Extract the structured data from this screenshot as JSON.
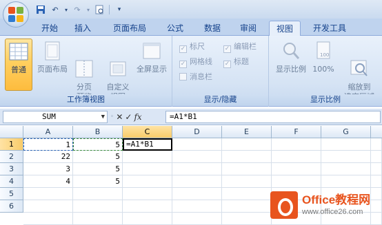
{
  "quick_access": {
    "icons": [
      "save-icon",
      "undo-icon",
      "redo-icon",
      "print-preview-icon",
      "customize-icon"
    ]
  },
  "tabs": [
    {
      "label": "开始"
    },
    {
      "label": "插入"
    },
    {
      "label": "页面布局"
    },
    {
      "label": "公式"
    },
    {
      "label": "数据"
    },
    {
      "label": "审阅"
    },
    {
      "label": "视图",
      "active": true
    },
    {
      "label": "开发工具"
    }
  ],
  "ribbon": {
    "groups": {
      "workbook_views": {
        "label": "工作簿视图",
        "buttons": [
          {
            "label": "普通",
            "active": true
          },
          {
            "label": "页面布局"
          },
          {
            "label": "分页\n预览"
          },
          {
            "label": "自定义\n视图"
          },
          {
            "label": "全屏显示"
          }
        ]
      },
      "show_hide": {
        "label": "显示/隐藏",
        "checks": [
          {
            "label": "标尺",
            "checked": true
          },
          {
            "label": "编辑栏",
            "checked": true
          },
          {
            "label": "网格线",
            "checked": true
          },
          {
            "label": "标题",
            "checked": true
          },
          {
            "label": "消息栏",
            "checked": false
          }
        ]
      },
      "zoom": {
        "label": "显示比例",
        "buttons": [
          {
            "label": "显示比例"
          },
          {
            "label": "100%"
          },
          {
            "label": "缩放到\n选定区域"
          }
        ]
      }
    }
  },
  "formula_bar": {
    "name_box": "SUM",
    "cancel": "✕",
    "enter": "✓",
    "fx": "fx",
    "formula": "=A1*B1"
  },
  "sheet": {
    "columns": [
      "A",
      "B",
      "C",
      "D",
      "E",
      "F",
      "G"
    ],
    "rows": [
      "1",
      "2",
      "3",
      "4",
      "5",
      "6"
    ],
    "cells": {
      "A1": "1",
      "B1": "5",
      "C1": "=A1*B1",
      "A2": "22",
      "B2": "5",
      "A3": "3",
      "B3": "5",
      "A4": "4",
      "B4": "5"
    },
    "active_column": "C",
    "active_row": "1"
  },
  "watermark": {
    "brand": "Office教程网",
    "url": "www.office26.com"
  }
}
